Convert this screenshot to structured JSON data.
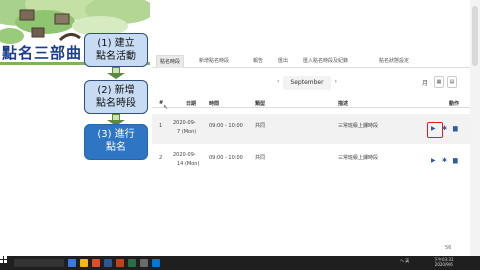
{
  "slide": {
    "title": "點名三部曲",
    "steps": [
      {
        "line1": "(1) 建立",
        "line2": "點名活動"
      },
      {
        "line1": "(2) 新增",
        "line2": "點名時段"
      },
      {
        "line1": "(3) 進行",
        "line2": "點名"
      }
    ]
  },
  "tabs": [
    {
      "label": "點名時段",
      "active": true
    },
    {
      "label": "新增點名時段",
      "active": false
    },
    {
      "label": "報告",
      "active": false
    },
    {
      "label": "匯出",
      "active": false
    },
    {
      "label": "匯入點名時段及紀錄",
      "active": false
    },
    {
      "label": "點名狀態設定",
      "active": false
    }
  ],
  "month_nav": {
    "month": "September",
    "left_icon": "chevron-left-icon",
    "right_icon": "chevron-right-icon"
  },
  "view_buttons": {
    "label": "月",
    "week_icon": "calendar-week-icon",
    "list_icon": "calendar-list-icon"
  },
  "table": {
    "headers": {
      "num": "#",
      "date": "日期",
      "time": "時間",
      "type": "類型",
      "description": "描述",
      "actions": "動作"
    },
    "rows": [
      {
        "num": "1",
        "date1": "2020-09-",
        "date2": "7 (Mon)",
        "time": "09:00 - 10:00",
        "type": "共同",
        "description": "三常班級上課時段"
      },
      {
        "num": "2",
        "date1": "2020-09-",
        "date2": "14 (Mon)",
        "time": "09:00 - 10:00",
        "type": "共同",
        "description": "三常班級上課時段"
      }
    ],
    "action_icons": [
      "play-icon",
      "gear-icon",
      "trash-icon"
    ]
  },
  "corner_number": "56",
  "taskbar": {
    "tray_text": "へ 英",
    "time": "下午03:31",
    "date": "2020/9/6",
    "colors": {
      "bar": "#1f1f1f",
      "accent": "#2e75c4"
    }
  }
}
